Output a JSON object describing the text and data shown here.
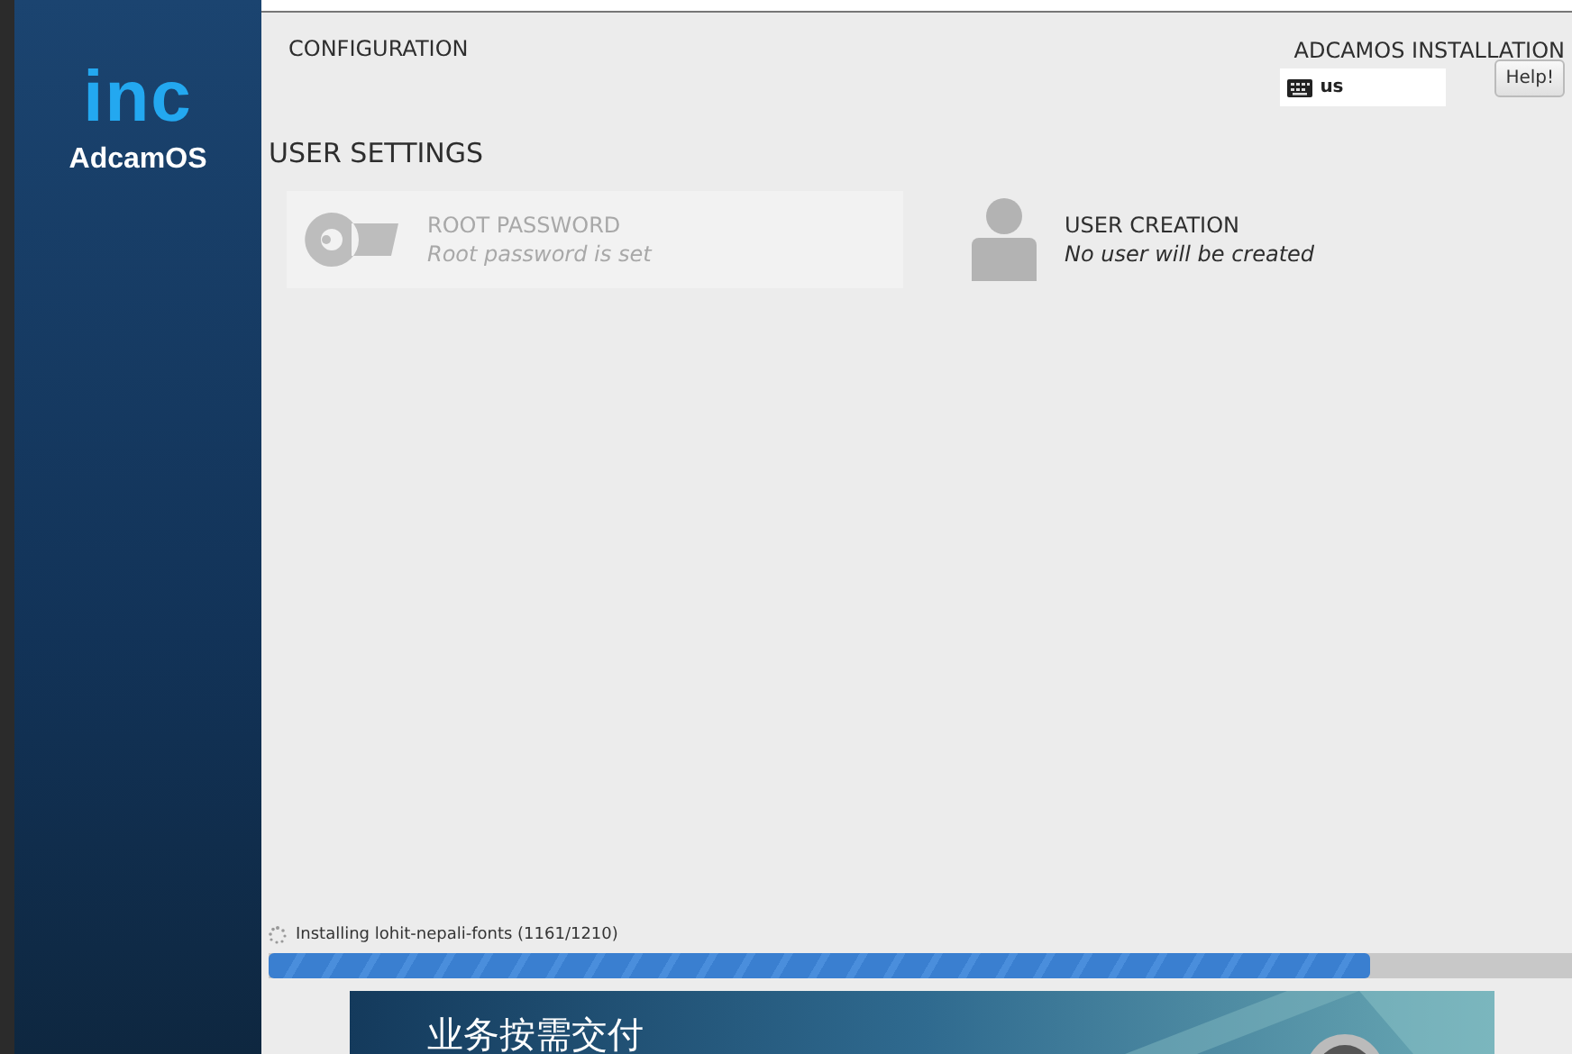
{
  "sidebar": {
    "logo": "inc",
    "product": "AdcamOS"
  },
  "header": {
    "title": "CONFIGURATION",
    "installer_title": "ADCAMOS INSTALLATION",
    "keyboard_layout": "us",
    "help_button": "Help!"
  },
  "section": {
    "title": "USER SETTINGS"
  },
  "spokes": [
    {
      "kind": "key",
      "title": "ROOT PASSWORD",
      "status": "Root password is set",
      "disabled": true
    },
    {
      "kind": "user",
      "title": "USER CREATION",
      "status": "No user will be created",
      "disabled": false
    }
  ],
  "progress": {
    "status": "Installing lohit-nepali-fonts (1161/1210)",
    "level": 0.845
  },
  "banner": {
    "text": "业务按需交付"
  }
}
